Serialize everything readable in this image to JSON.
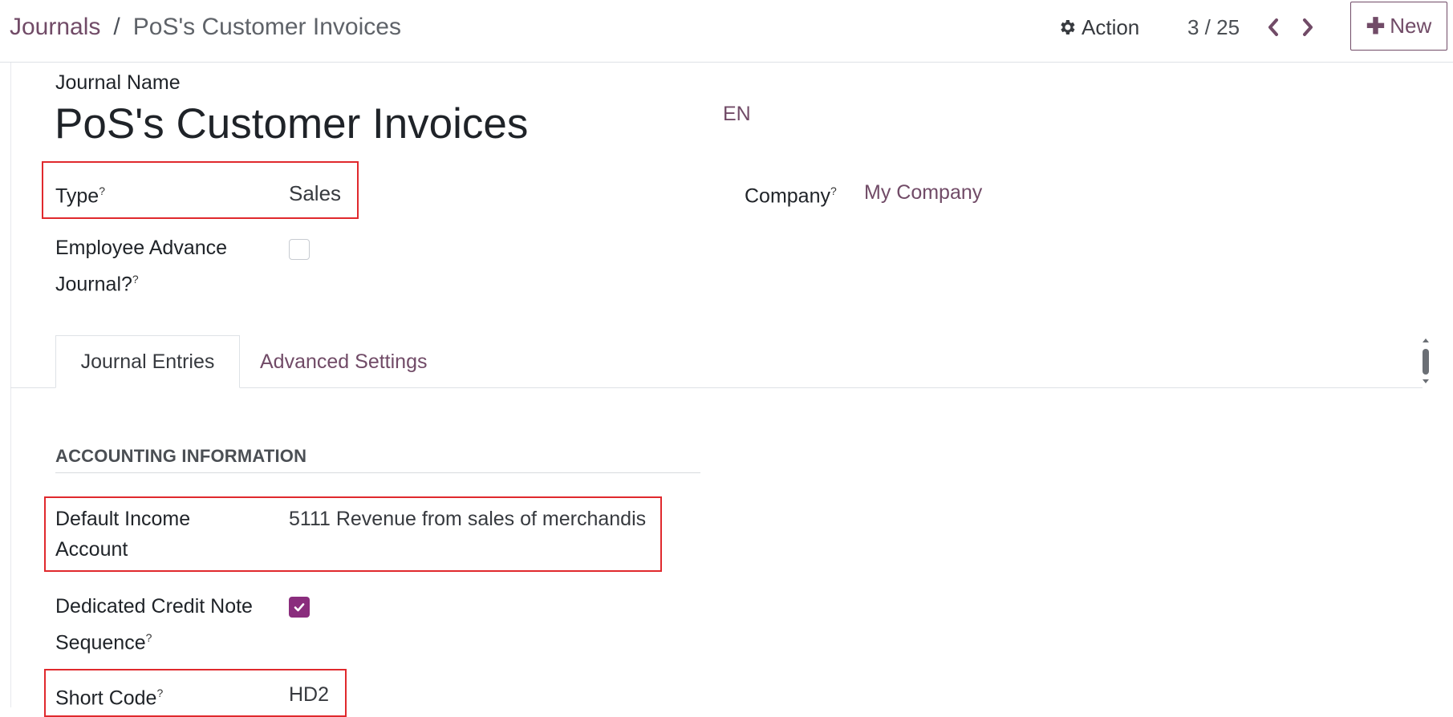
{
  "breadcrumb": {
    "parent": "Journals",
    "separator": "/",
    "current": "PoS's Customer Invoices"
  },
  "toolbar": {
    "action_label": "Action",
    "pager": "3 / 25",
    "new_label": "New"
  },
  "form": {
    "name_label": "Journal Name",
    "name_value": "PoS's Customer Invoices",
    "language": "EN",
    "type_label": "Type",
    "type_value": "Sales",
    "company_label": "Company",
    "company_value": "My Company",
    "employee_advance_label_line1": "Employee Advance",
    "employee_advance_label_line2": "Journal?",
    "employee_advance_checked": false,
    "help_marker": "?"
  },
  "tabs": [
    {
      "label": "Journal Entries",
      "active": true
    },
    {
      "label": "Advanced Settings",
      "active": false
    }
  ],
  "accounting": {
    "section_title": "ACCOUNTING INFORMATION",
    "income_label_line1": "Default Income",
    "income_label_line2": "Account",
    "income_value": "5111 Revenue from sales of merchandis",
    "credit_note_label_line1": "Dedicated Credit Note",
    "credit_note_label_line2": "Sequence",
    "credit_note_checked": true,
    "short_code_label": "Short Code",
    "short_code_value": "HD2"
  },
  "colors": {
    "accent": "#714b67",
    "checkbox_checked": "#8a2d7d",
    "highlight_box": "#e0292d"
  }
}
